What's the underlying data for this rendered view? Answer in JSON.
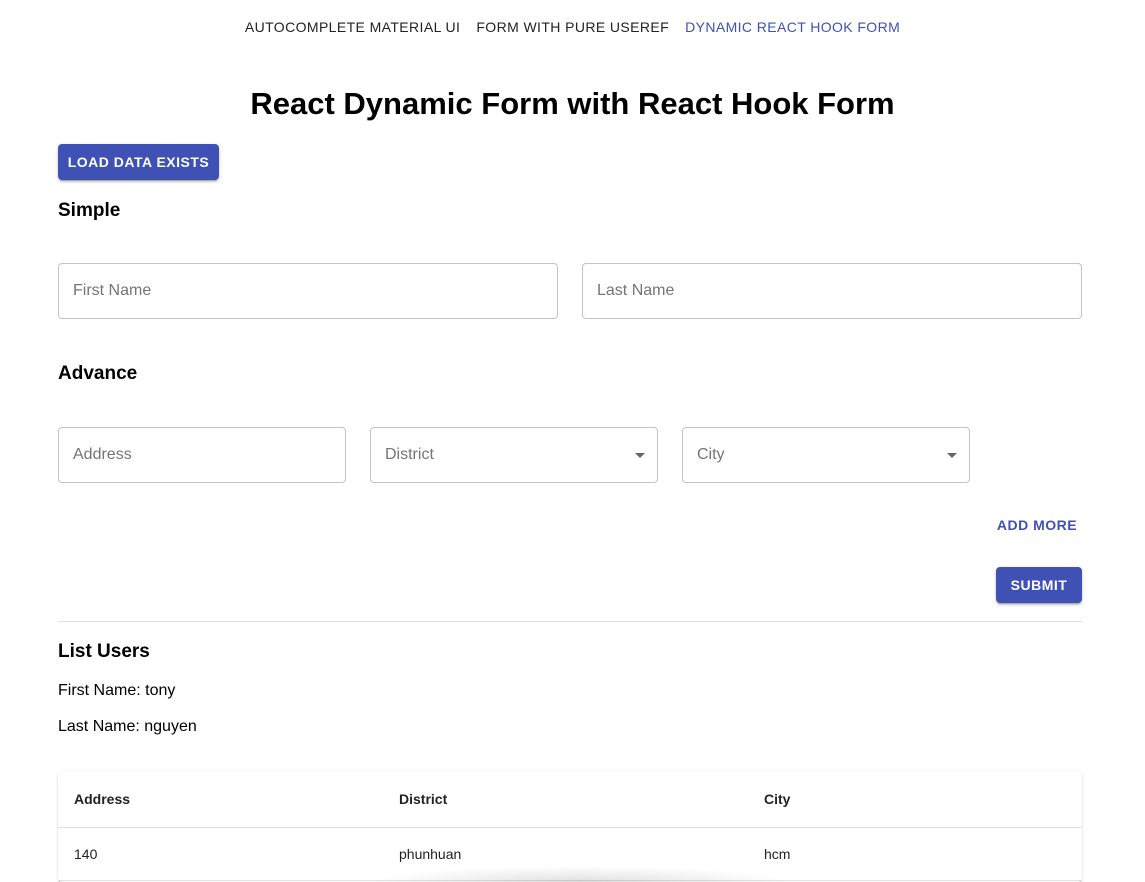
{
  "nav": {
    "items": [
      {
        "label": "AUTOCOMPLETE MATERIAL UI",
        "active": false
      },
      {
        "label": "FORM WITH PURE USEREF",
        "active": false
      },
      {
        "label": "DYNAMIC REACT HOOK FORM",
        "active": true
      }
    ]
  },
  "page": {
    "title": "React Dynamic Form with React Hook Form"
  },
  "buttons": {
    "load_data": "LOAD DATA EXISTS",
    "add_more": "ADD MORE",
    "submit": "SUBMIT"
  },
  "simple": {
    "title": "Simple",
    "first_name_placeholder": "First Name",
    "first_name_value": "",
    "last_name_placeholder": "Last Name",
    "last_name_value": ""
  },
  "advance": {
    "title": "Advance",
    "address_placeholder": "Address",
    "address_value": "",
    "district_label": "District",
    "city_label": "City"
  },
  "list_users": {
    "title": "List Users",
    "first_name_line": "First Name: tony",
    "last_name_line": "Last Name: nguyen",
    "table": {
      "headers": [
        "Address",
        "District",
        "City"
      ],
      "rows": [
        [
          "140",
          "phunhuan",
          "hcm"
        ]
      ]
    }
  },
  "colors": {
    "primary": "#3f51b5",
    "border": "#c4c4c4",
    "divider": "#e0e0e0"
  },
  "icons": {
    "select_caret": "arrow-drop-down-icon"
  }
}
